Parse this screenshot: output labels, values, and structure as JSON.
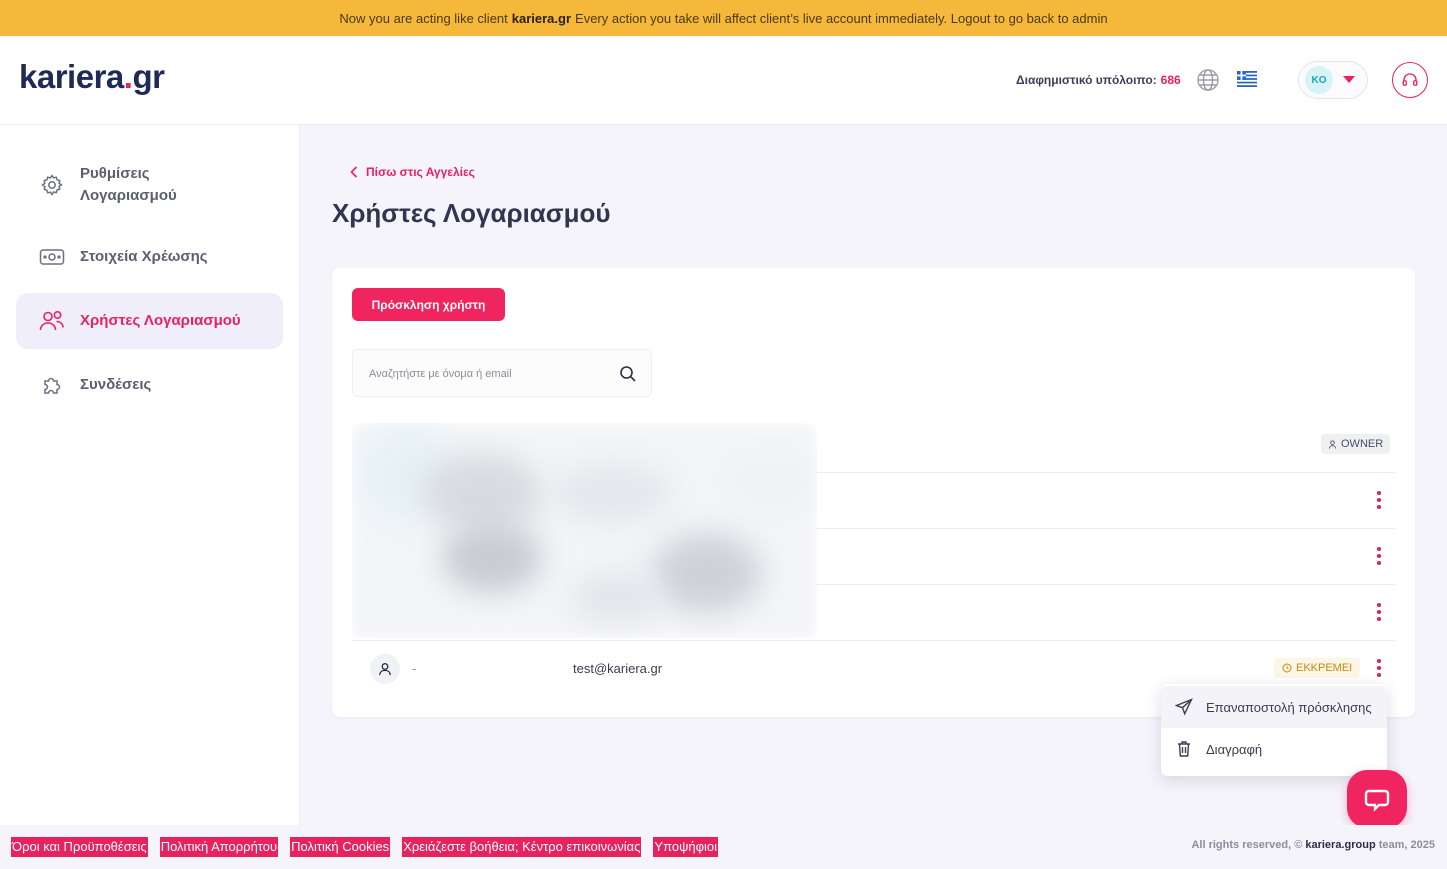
{
  "banner": {
    "prefix": "Now you are acting like client",
    "client": "kariera.gr",
    "suffix": "Every action you take will affect client’s live account immediately. Logout to go back to admin"
  },
  "header": {
    "logo_main": "kariera",
    "logo_dot": ".",
    "logo_tld": "gr",
    "balance_label": "Διαφημιστικό υπόλοιπο:",
    "balance_value": "686",
    "user_initials": "KO",
    "icons": [
      "globe-icon",
      "greek-flag-icon",
      "chevron-down-icon",
      "headset-icon"
    ]
  },
  "sidebar": {
    "items": [
      {
        "label": "Ρυθμίσεις Λογαριασμού",
        "icon": "gear-icon",
        "active": false
      },
      {
        "label": "Στοιχεία Χρέωσης",
        "icon": "banknote-icon",
        "active": false
      },
      {
        "label": "Χρήστες Λογαριασμού",
        "icon": "users-icon",
        "active": true
      },
      {
        "label": "Συνδέσεις",
        "icon": "puzzle-icon",
        "active": false
      }
    ]
  },
  "main": {
    "back_link": "Πίσω στις Αγγελίες",
    "title": "Χρήστες Λογαριασμού",
    "invite_button": "Πρόσκληση χρήστη",
    "search_placeholder": "Αναζητήστε με όνομα ή email",
    "owner_badge": "OWNER",
    "pending_user": {
      "name": "-",
      "email": "test@kariera.gr",
      "status": "ΕΚΚΡΕΜΕΙ"
    },
    "row_menu": {
      "resend": "Επαναποστολή πρόσκλησης",
      "delete": "Διαγραφή"
    }
  },
  "footer": {
    "links": [
      "Όροι και Προϋποθέσεις",
      "Πολιτική Απορρήτου",
      "Πολιτική Cookies",
      "Χρειάζεστε βοήθεια; Κέντρο επικοινωνίας",
      "Υποψήφιοι"
    ],
    "copyright_prefix": "All rights reserved, ©",
    "copyright_brand": "kariera.group",
    "copyright_suffix": "team, 2025"
  },
  "colors": {
    "accent": "#e8215f",
    "banner": "#f6b83a",
    "brand_navy": "#1f2a57",
    "pending": "#c98a10"
  }
}
